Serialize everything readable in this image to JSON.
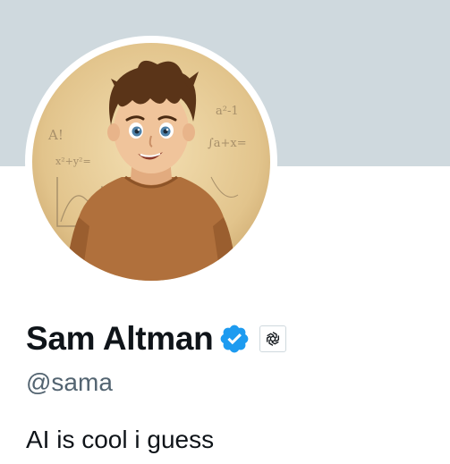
{
  "banner": {
    "color": "#cfd9de"
  },
  "profile": {
    "display_name": "Sam Altman",
    "handle": "@sama",
    "bio": "AI is cool i guess",
    "verified_icon": "verified-badge-icon",
    "verified_color": "#1d9bf0",
    "affiliate_icon": "openai-logo-icon"
  },
  "avatar": {
    "description_icon": "avatar-illustration",
    "chalkboard_text": [
      "A!",
      "x²+y²=",
      "a²-1",
      "∫a+x="
    ]
  },
  "colors": {
    "name_text": "#0f1419",
    "secondary_text": "#536471"
  }
}
